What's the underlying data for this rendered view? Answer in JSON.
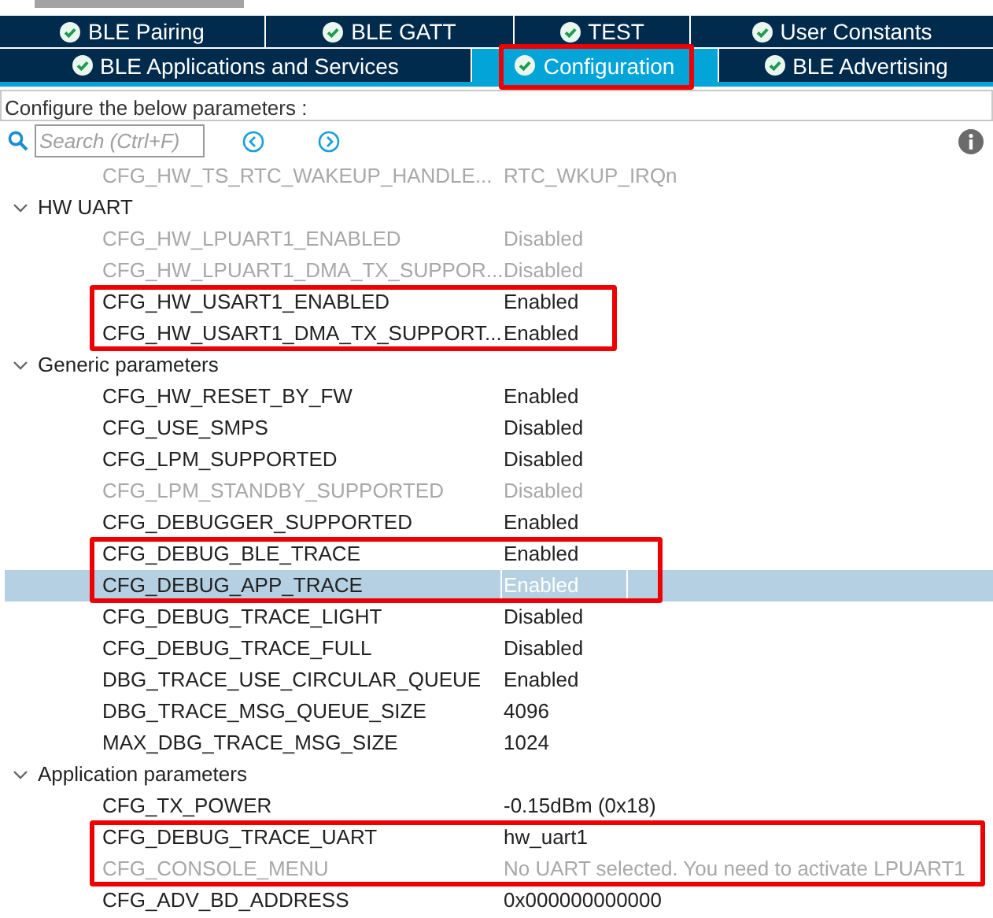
{
  "tab_rows": [
    [
      {
        "label": "BLE Pairing",
        "selected": false,
        "marked": false
      },
      {
        "label": "BLE GATT",
        "selected": false,
        "marked": false
      },
      {
        "label": "TEST",
        "selected": false,
        "marked": false
      },
      {
        "label": "User Constants",
        "selected": false,
        "marked": false
      }
    ],
    [
      {
        "label": "BLE Applications and Services",
        "selected": false,
        "marked": false
      },
      {
        "label": "Configuration",
        "selected": true,
        "marked": true
      },
      {
        "label": "BLE Advertising",
        "selected": false,
        "marked": false
      }
    ]
  ],
  "description": "Configure the below parameters :",
  "search": {
    "placeholder": "Search (Ctrl+F)"
  },
  "tree": [
    {
      "kind": "param",
      "name": "CFG_HW_TS_RTC_WAKEUP_HANDLE...",
      "value": "RTC_WKUP_IRQn",
      "disabled": true,
      "selected": false,
      "marked": false
    },
    {
      "kind": "group",
      "label": "HW UART",
      "expanded": true,
      "children": [
        {
          "kind": "param",
          "name": "CFG_HW_LPUART1_ENABLED",
          "value": "Disabled",
          "disabled": true,
          "selected": false,
          "marked": false
        },
        {
          "kind": "param",
          "name": "CFG_HW_LPUART1_DMA_TX_SUPPOR...",
          "value": "Disabled",
          "disabled": true,
          "selected": false,
          "marked": false
        },
        {
          "kind": "param",
          "name": "CFG_HW_USART1_ENABLED",
          "value": "Enabled",
          "disabled": false,
          "selected": false,
          "marked": true
        },
        {
          "kind": "param",
          "name": "CFG_HW_USART1_DMA_TX_SUPPORT...",
          "value": "Enabled",
          "disabled": false,
          "selected": false,
          "marked": true
        }
      ]
    },
    {
      "kind": "group",
      "label": "Generic parameters",
      "expanded": true,
      "children": [
        {
          "kind": "param",
          "name": "CFG_HW_RESET_BY_FW",
          "value": "Enabled",
          "disabled": false,
          "selected": false,
          "marked": false
        },
        {
          "kind": "param",
          "name": "CFG_USE_SMPS",
          "value": "Disabled",
          "disabled": false,
          "selected": false,
          "marked": false
        },
        {
          "kind": "param",
          "name": "CFG_LPM_SUPPORTED",
          "value": "Disabled",
          "disabled": false,
          "selected": false,
          "marked": false
        },
        {
          "kind": "param",
          "name": "CFG_LPM_STANDBY_SUPPORTED",
          "value": "Disabled",
          "disabled": true,
          "selected": false,
          "marked": false
        },
        {
          "kind": "param",
          "name": "CFG_DEBUGGER_SUPPORTED",
          "value": "Enabled",
          "disabled": false,
          "selected": false,
          "marked": false
        },
        {
          "kind": "param",
          "name": "CFG_DEBUG_BLE_TRACE",
          "value": "Enabled",
          "disabled": false,
          "selected": false,
          "marked": true
        },
        {
          "kind": "param",
          "name": "CFG_DEBUG_APP_TRACE",
          "value": "Enabled",
          "disabled": false,
          "selected": true,
          "marked": true
        },
        {
          "kind": "param",
          "name": "CFG_DEBUG_TRACE_LIGHT",
          "value": "Disabled",
          "disabled": false,
          "selected": false,
          "marked": false
        },
        {
          "kind": "param",
          "name": "CFG_DEBUG_TRACE_FULL",
          "value": "Disabled",
          "disabled": false,
          "selected": false,
          "marked": false
        },
        {
          "kind": "param",
          "name": "DBG_TRACE_USE_CIRCULAR_QUEUE",
          "value": "Enabled",
          "disabled": false,
          "selected": false,
          "marked": false
        },
        {
          "kind": "param",
          "name": "DBG_TRACE_MSG_QUEUE_SIZE",
          "value": "4096",
          "disabled": false,
          "selected": false,
          "marked": false
        },
        {
          "kind": "param",
          "name": "MAX_DBG_TRACE_MSG_SIZE",
          "value": "1024",
          "disabled": false,
          "selected": false,
          "marked": false
        }
      ]
    },
    {
      "kind": "group",
      "label": "Application parameters",
      "expanded": true,
      "children": [
        {
          "kind": "param",
          "name": "CFG_TX_POWER",
          "value": "-0.15dBm (0x18)",
          "disabled": false,
          "selected": false,
          "marked": false
        },
        {
          "kind": "param",
          "name": "CFG_DEBUG_TRACE_UART",
          "value": "hw_uart1",
          "disabled": false,
          "selected": false,
          "marked": true
        },
        {
          "kind": "param",
          "name": "CFG_CONSOLE_MENU",
          "value": "No UART selected. You need to activate LPUART1",
          "disabled": true,
          "selected": false,
          "marked": true
        },
        {
          "kind": "param",
          "name": "CFG_ADV_BD_ADDRESS",
          "value": "0x000000000000",
          "disabled": false,
          "selected": false,
          "marked": false
        }
      ]
    }
  ]
}
